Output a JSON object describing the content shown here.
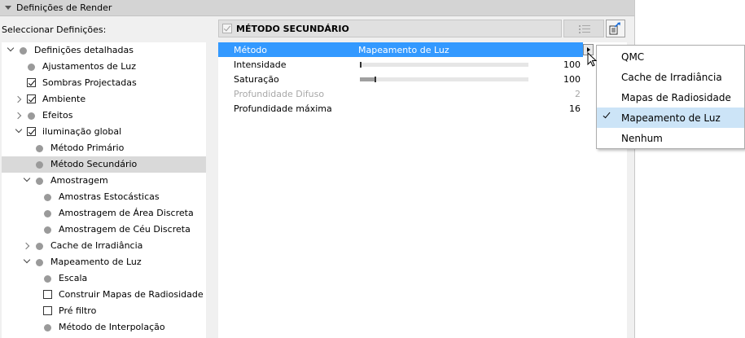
{
  "panel": {
    "title": "Definições de Render"
  },
  "tree": {
    "label": "Seleccionar Definições:",
    "items": [
      {
        "label": "Definições detalhadas"
      },
      {
        "label": "Ajustamentos de Luz"
      },
      {
        "label": "Sombras Projectadas"
      },
      {
        "label": "Ambiente"
      },
      {
        "label": "Efeitos"
      },
      {
        "label": "iluminação global"
      },
      {
        "label": "Método Primário"
      },
      {
        "label": "Método Secundário"
      },
      {
        "label": "Amostragem"
      },
      {
        "label": "Amostras Estocásticas"
      },
      {
        "label": "Amostragem de Área Discreta"
      },
      {
        "label": "Amostragem de Céu Discreta"
      },
      {
        "label": "Cache de Irradiância"
      },
      {
        "label": "Mapeamento de Luz"
      },
      {
        "label": "Escala"
      },
      {
        "label": "Construir Mapas de Radiosidade"
      },
      {
        "label": "Pré filtro"
      },
      {
        "label": "Método de Interpolação"
      }
    ]
  },
  "section": {
    "title": "MÉTODO SECUNDÁRIO"
  },
  "properties": [
    {
      "name": "Método",
      "value": "Mapeamento de Luz"
    },
    {
      "name": "Intensidade",
      "value": "100",
      "slider_fraction": 0.0
    },
    {
      "name": "Saturação",
      "value": "100",
      "slider_fraction": 0.09
    },
    {
      "name": "Profundidade Difuso",
      "value": "2"
    },
    {
      "name": "Profundidade máxima",
      "value": "16"
    }
  ],
  "dropdown": {
    "options": [
      {
        "label": "QMC"
      },
      {
        "label": "Cache de Irradiância"
      },
      {
        "label": "Mapas de Radiosidade"
      },
      {
        "label": "Mapeamento de Luz",
        "checked": true
      },
      {
        "label": "Nenhum"
      }
    ]
  },
  "colors": {
    "selection": "#3399ff",
    "menu_highlight": "#cce4f7",
    "tree_selected": "#d9d9d9"
  }
}
